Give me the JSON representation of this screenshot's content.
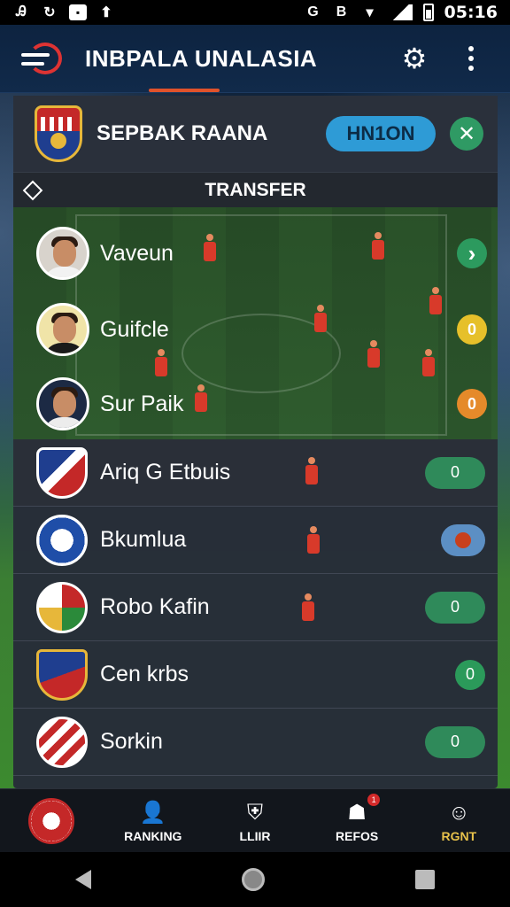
{
  "status_bar": {
    "time": "05:16"
  },
  "header": {
    "title": "INBPALA UNALASIA"
  },
  "team": {
    "name": "SEPBAK RAANA",
    "join_label": "HN1ON"
  },
  "section": {
    "title": "TRANSFER"
  },
  "players": [
    {
      "name": "Vaveun",
      "action": "›",
      "action_color": "#2c9a5e"
    },
    {
      "name": "Guifcle",
      "action": "0",
      "action_color": "#e6c02a"
    },
    {
      "name": "Sur Paik",
      "action": "0",
      "action_color": "#e58a2a"
    }
  ],
  "clubs": [
    {
      "name": "Ariq G Etbuis",
      "value": "0"
    },
    {
      "name": "Bkumlua",
      "value": ""
    },
    {
      "name": "Robo Kafin",
      "value": "0"
    },
    {
      "name": "Cen krbs",
      "value": "0"
    },
    {
      "name": "Sorkin",
      "value": "0"
    }
  ],
  "bottom_nav": {
    "items": [
      {
        "label": ""
      },
      {
        "label": "RANKING"
      },
      {
        "label": "LLIIR"
      },
      {
        "label": "REFOS",
        "badge": "1"
      },
      {
        "label": "RGNT"
      }
    ]
  },
  "colors": {
    "accent_blue": "#2e9bd6",
    "accent_green": "#2f8a5a",
    "accent_red": "#e0522b"
  }
}
